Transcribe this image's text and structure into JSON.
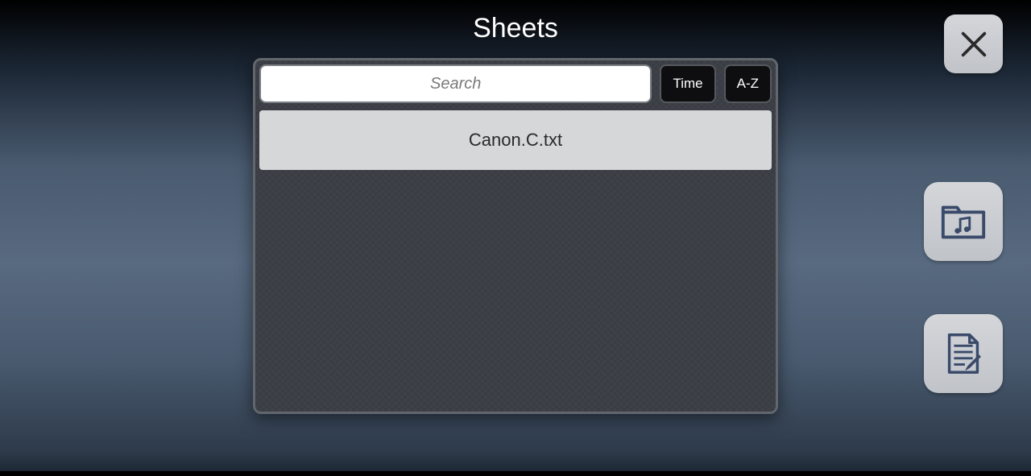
{
  "title": "Sheets",
  "search": {
    "placeholder": "Search",
    "value": ""
  },
  "sort": {
    "time_label": "Time",
    "az_label": "A-Z"
  },
  "files": [
    {
      "name": "Canon.C.txt"
    }
  ],
  "colors": {
    "icon": "#3a4a6a"
  }
}
